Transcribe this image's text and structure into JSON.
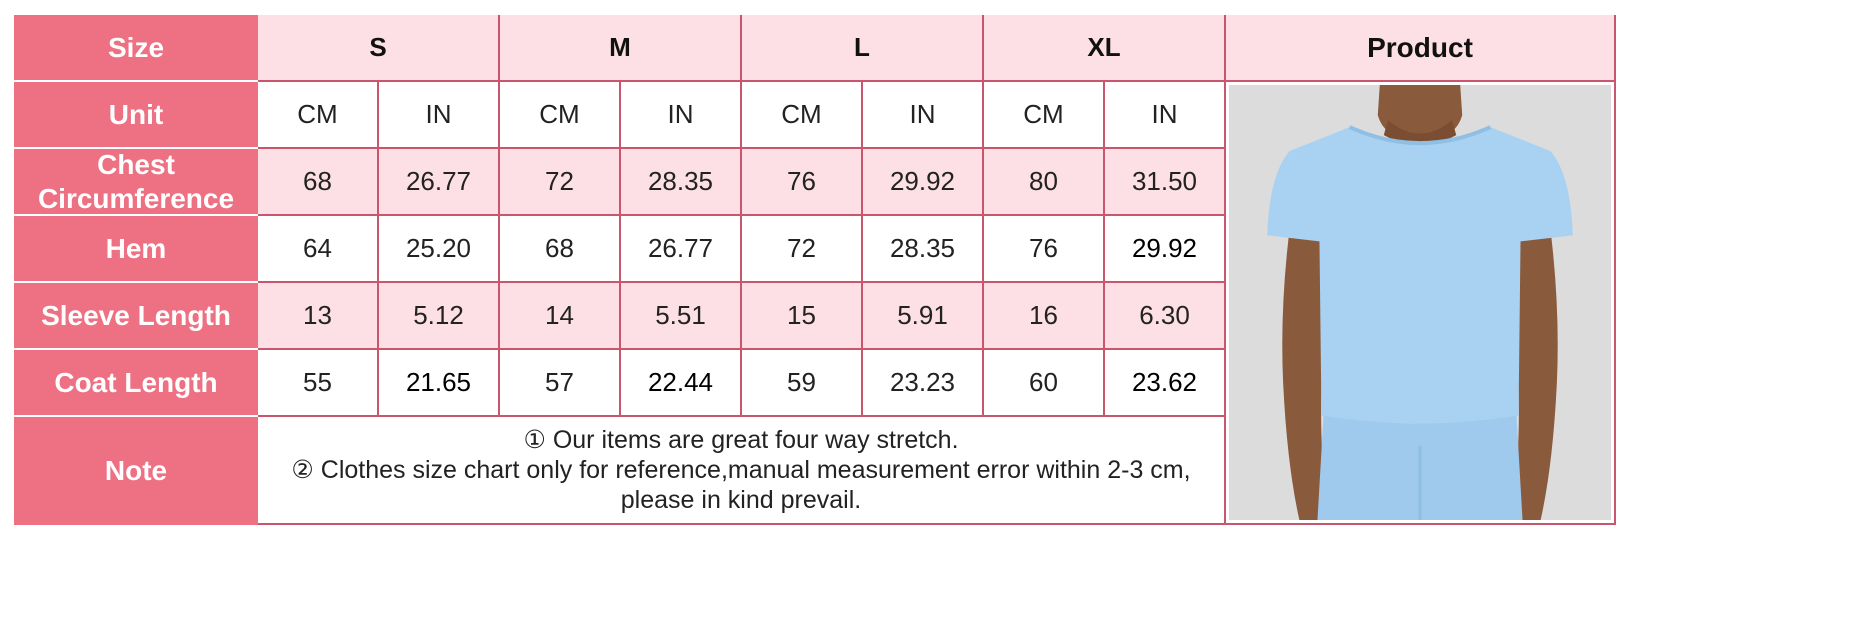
{
  "labels": {
    "size": "Size",
    "unit": "Unit",
    "chest": "Chest Circumference",
    "hem": "Hem",
    "sleeve": "Sleeve Length",
    "coat": "Coat Length",
    "note": "Note",
    "product": "Product"
  },
  "sizes": [
    "S",
    "M",
    "L",
    "XL"
  ],
  "units": [
    "CM",
    "IN",
    "CM",
    "IN",
    "CM",
    "IN",
    "CM",
    "IN"
  ],
  "rows": {
    "chest": [
      "68",
      "26.77",
      "72",
      "28.35",
      "76",
      "29.92",
      "80",
      "31.50"
    ],
    "hem": [
      "64",
      "25.20",
      "68",
      "26.77",
      "72",
      "28.35",
      "76",
      "29.92"
    ],
    "sleeve": [
      "13",
      "5.12",
      "14",
      "5.51",
      "15",
      "5.91",
      "16",
      "6.30"
    ],
    "coat": [
      "55",
      "21.65",
      "57",
      "22.44",
      "59",
      "23.23",
      "60",
      "23.62"
    ]
  },
  "note_lines": [
    "① Our items are great four way stretch.",
    "② Clothes size chart only for reference,manual measurement error within 2-3 cm,",
    "please in kind prevail."
  ],
  "colors": {
    "header_bg": "#ed7183",
    "pink_row": "#fde0e5",
    "border": "#c9566c",
    "shirt": "#a9d2f2"
  },
  "product_image": "light-blue-short-sleeve-top-photo"
}
